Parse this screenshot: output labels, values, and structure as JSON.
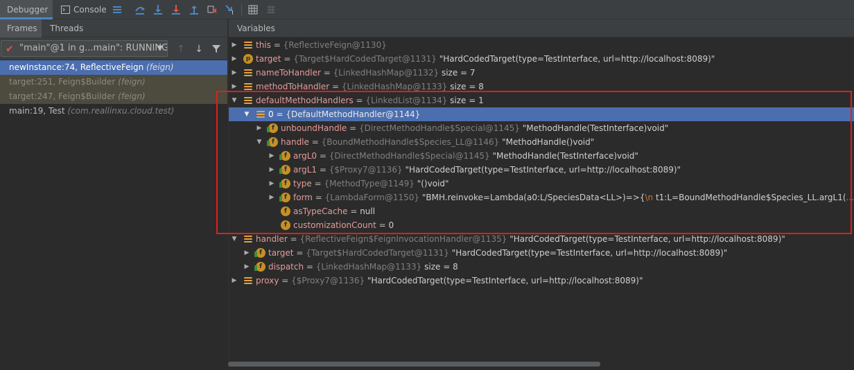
{
  "toolbar": {
    "tabs": [
      {
        "label": "Debugger"
      },
      {
        "label": "Console"
      }
    ]
  },
  "frames_panel": {
    "tabs": [
      {
        "label": "Frames"
      },
      {
        "label": "Threads"
      }
    ],
    "thread_selector": {
      "value": "\"main\"@1 in g...main\": RUNNING"
    },
    "frames": [
      {
        "method": "newInstance:74, ReflectiveFeign",
        "cls": "(feign)"
      },
      {
        "method": "target:251, Feign$Builder",
        "cls": "(feign)"
      },
      {
        "method": "target:247, Feign$Builder",
        "cls": "(feign)"
      },
      {
        "method": "main:19, Test",
        "cls": "(com.reallinxu.cloud.test)"
      }
    ]
  },
  "variables": {
    "header": "Variables",
    "rows": [
      {
        "name": "this",
        "ref": "{ReflectiveFeign@1130}",
        "value": ""
      },
      {
        "name": "target",
        "ref": "{Target$HardCodedTarget@1131}",
        "value": "\"HardCodedTarget(type=TestInterface, url=http://localhost:8089)\""
      },
      {
        "name": "nameToHandler",
        "ref": "{LinkedHashMap@1132}",
        "value": " size = 7"
      },
      {
        "name": "methodToHandler",
        "ref": "{LinkedHashMap@1133}",
        "value": " size = 8"
      },
      {
        "name": "defaultMethodHandlers",
        "ref": "{LinkedList@1134}",
        "value": " size = 1"
      },
      {
        "name": "0",
        "ref": "{DefaultMethodHandler@1144}",
        "value": ""
      },
      {
        "name": "unboundHandle",
        "ref": "{DirectMethodHandle$Special@1145}",
        "value": "\"MethodHandle(TestInterface)void\""
      },
      {
        "name": "handle",
        "ref": "{BoundMethodHandle$Species_LL@1146}",
        "value": "\"MethodHandle()void\""
      },
      {
        "name": "argL0",
        "ref": "{DirectMethodHandle$Special@1145}",
        "value": "\"MethodHandle(TestInterface)void\""
      },
      {
        "name": "argL1",
        "ref": "{$Proxy7@1136}",
        "value": "\"HardCodedTarget(type=TestInterface, url=http://localhost:8089)\""
      },
      {
        "name": "type",
        "ref": "{MethodType@1149}",
        "value": "\"()void\""
      },
      {
        "name": "form",
        "ref": "{LambdaForm@1150}",
        "value": "\"BMH.reinvoke=Lambda(a0:L/SpeciesData<LL>)=>{",
        "nl": "\\n",
        "value2": "    t1:L=BoundMethodHandle$Species_LL.argL1(",
        "view": "... View"
      },
      {
        "name": "asTypeCache",
        "ref": "",
        "value": "null"
      },
      {
        "name": "customizationCount",
        "ref": "",
        "value": "0"
      },
      {
        "name": "handler",
        "ref": "{ReflectiveFeign$FeignInvocationHandler@1135}",
        "value": "\"HardCodedTarget(type=TestInterface, url=http://localhost:8089)\""
      },
      {
        "name": "target",
        "ref": "{Target$HardCodedTarget@1131}",
        "value": "\"HardCodedTarget(type=TestInterface, url=http://localhost:8089)\""
      },
      {
        "name": "dispatch",
        "ref": "{LinkedHashMap@1133}",
        "value": " size = 8"
      },
      {
        "name": "proxy",
        "ref": "{$Proxy7@1136}",
        "value": "\"HardCodedTarget(type=TestInterface, url=http://localhost:8089)\""
      }
    ]
  },
  "colors": {
    "accent": "#4b6eaf",
    "highlight_box": "#e01e1e",
    "var_name": "#e59b9b",
    "icon_orange": "#e8a33d"
  },
  "icons": [
    "rerun-icon",
    "step-over-icon",
    "step-into-icon",
    "force-step-into-icon",
    "step-out-icon",
    "drop-frame-icon",
    "run-to-cursor-icon",
    "evaluate-icon",
    "table-icon",
    "restore-layout-icon"
  ]
}
